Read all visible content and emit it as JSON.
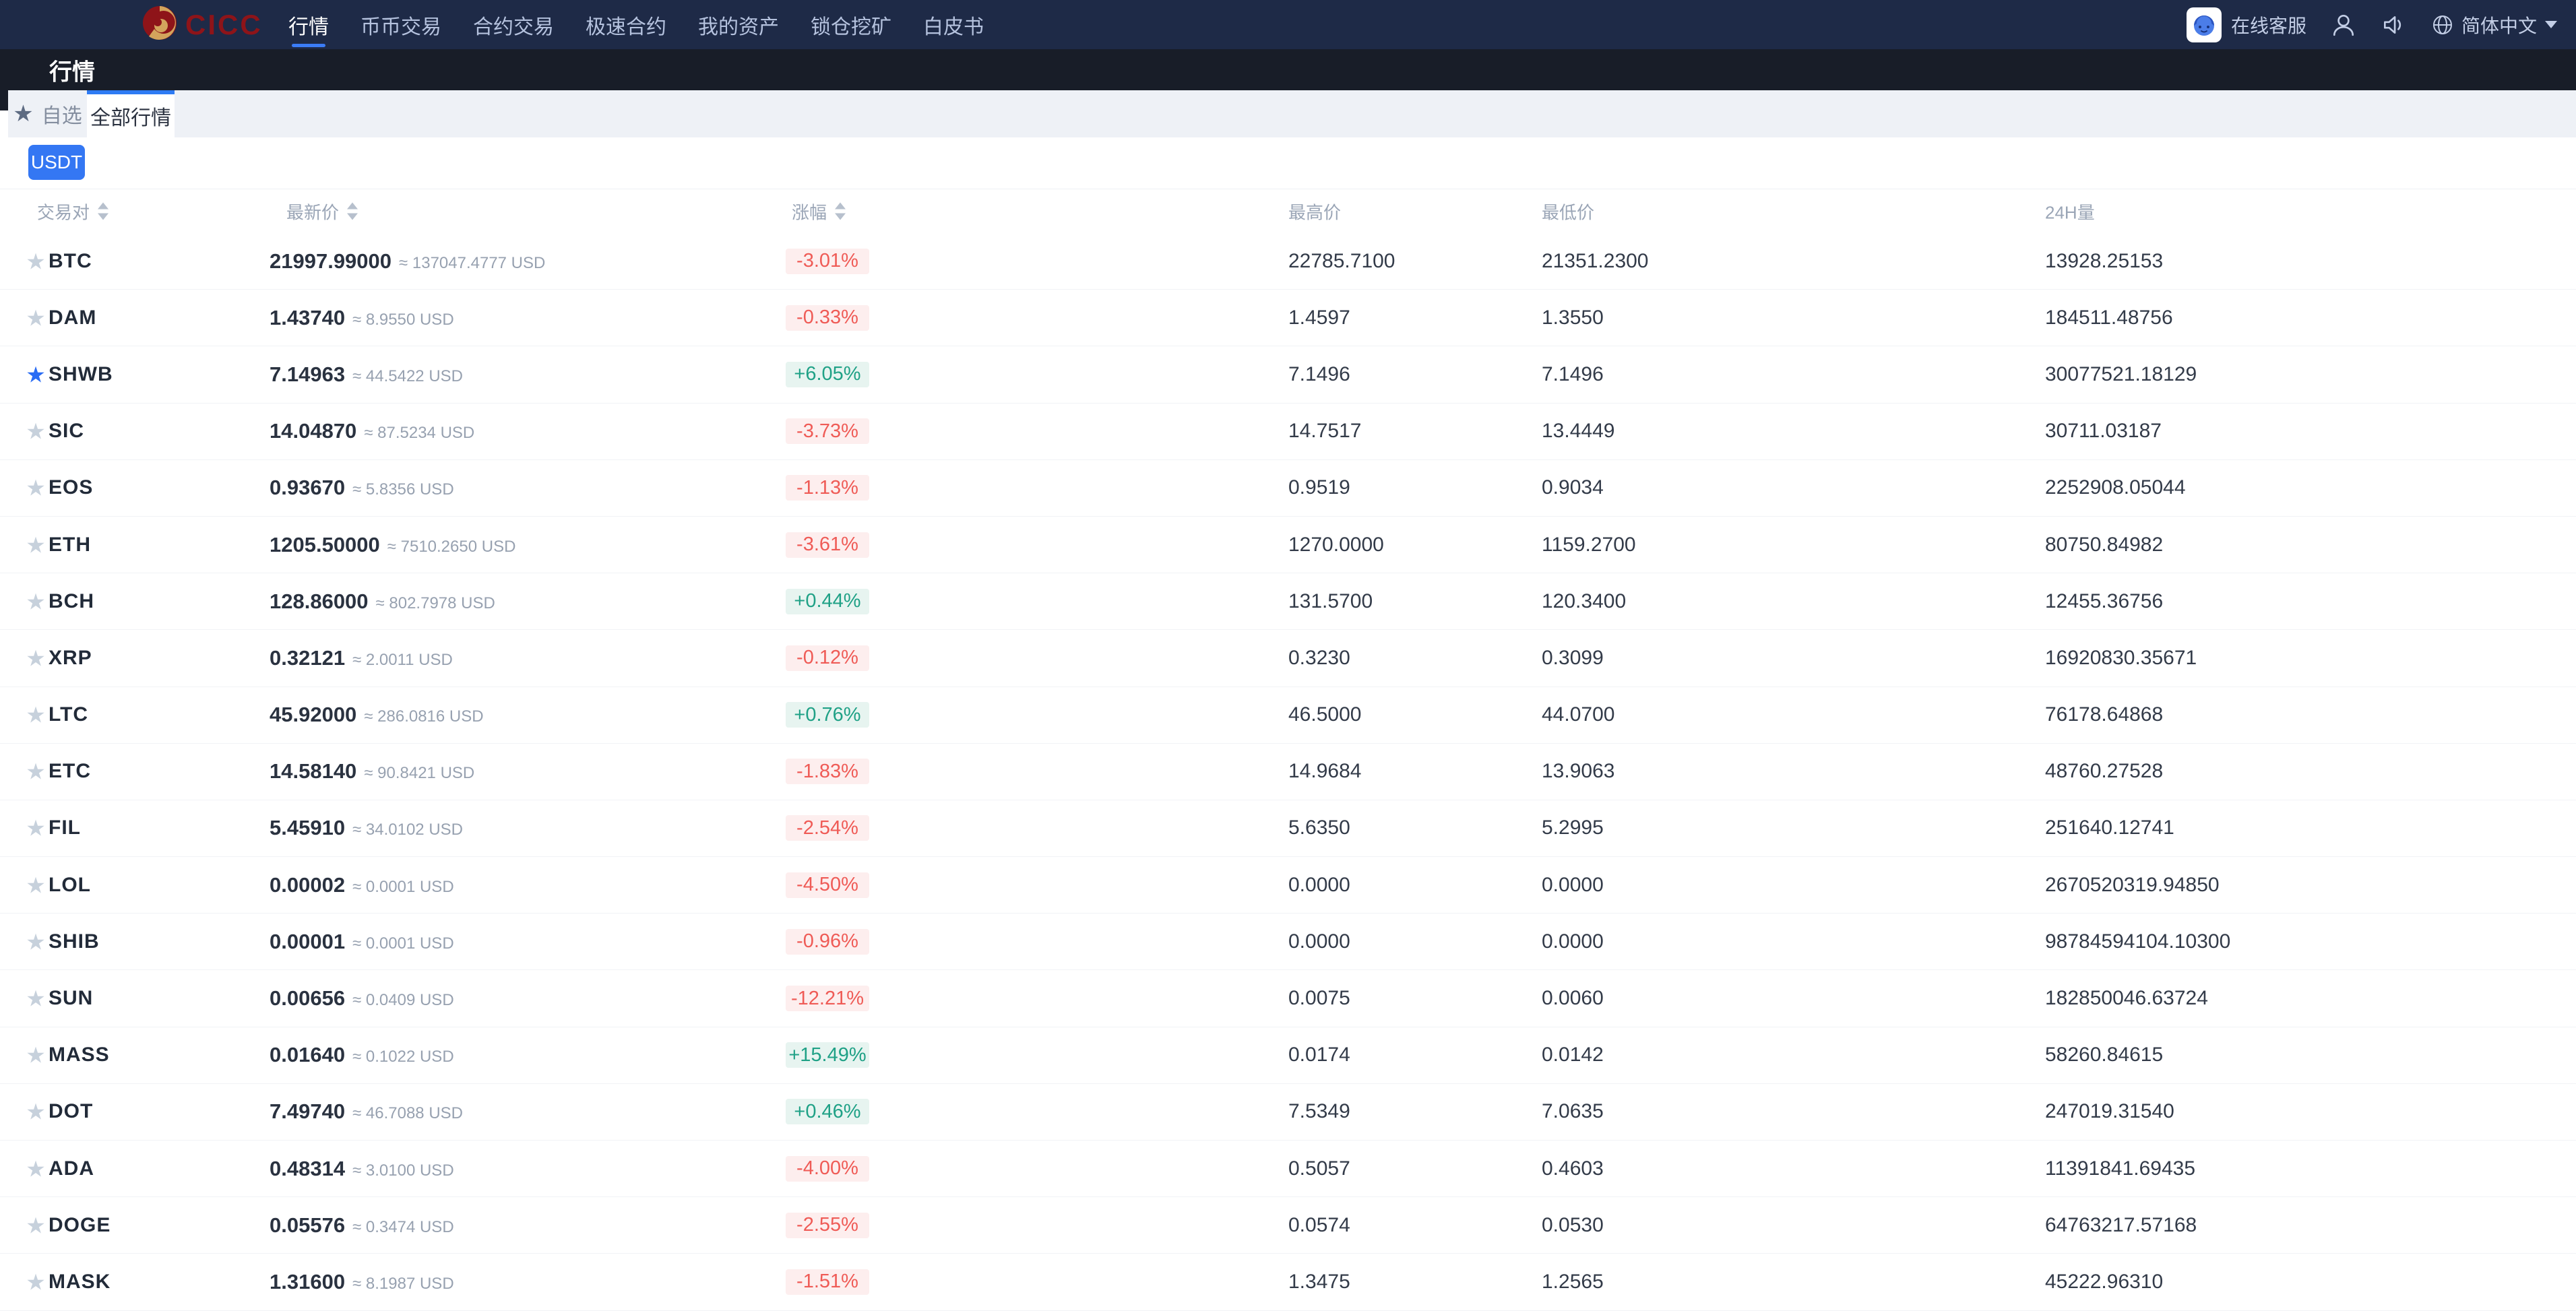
{
  "nav": {
    "brand": "CICC",
    "items": [
      {
        "label": "行情",
        "active": true
      },
      {
        "label": "币币交易",
        "active": false
      },
      {
        "label": "合约交易",
        "active": false
      },
      {
        "label": "极速合约",
        "active": false
      },
      {
        "label": "我的资产",
        "active": false
      },
      {
        "label": "锁仓挖矿",
        "active": false
      },
      {
        "label": "白皮书",
        "active": false
      }
    ],
    "right": {
      "support_label": "在线客服",
      "language": "简体中文"
    }
  },
  "subheader": {
    "title": "行情"
  },
  "tabs": [
    {
      "label": "自选",
      "active": false
    },
    {
      "label": "全部行情",
      "active": true
    }
  ],
  "filter": {
    "usdt_label": "USDT"
  },
  "icons": {
    "star": "★"
  },
  "colors": {
    "accent_blue": "#3477f3",
    "navbar_bg": "#1e2a47",
    "subbar_bg": "#181d28",
    "up_green": "#1fa186",
    "down_red": "#ef5b56",
    "brand_red": "#8e1419",
    "brand_gold": "#d3a45c"
  },
  "table": {
    "columns": [
      {
        "label": "交易对",
        "sortable": true
      },
      {
        "label": "最新价",
        "sortable": true
      },
      {
        "label": "涨幅",
        "sortable": true
      },
      {
        "label": "最高价",
        "sortable": false
      },
      {
        "label": "最低价",
        "sortable": false
      },
      {
        "label": "24H量",
        "sortable": false
      }
    ],
    "rows": [
      {
        "symbol": "BTC",
        "starred": false,
        "price": "21997.99000",
        "approx": "≈ 137047.4777 USD",
        "change": "-3.01%",
        "dir": "down",
        "high": "22785.7100",
        "low": "21351.2300",
        "volume": "13928.25153"
      },
      {
        "symbol": "DAM",
        "starred": false,
        "price": "1.43740",
        "approx": "≈ 8.9550 USD",
        "change": "-0.33%",
        "dir": "down",
        "high": "1.4597",
        "low": "1.3550",
        "volume": "184511.48756"
      },
      {
        "symbol": "SHWB",
        "starred": true,
        "price": "7.14963",
        "approx": "≈ 44.5422 USD",
        "change": "+6.05%",
        "dir": "up",
        "high": "7.1496",
        "low": "7.1496",
        "volume": "30077521.18129"
      },
      {
        "symbol": "SIC",
        "starred": false,
        "price": "14.04870",
        "approx": "≈ 87.5234 USD",
        "change": "-3.73%",
        "dir": "down",
        "high": "14.7517",
        "low": "13.4449",
        "volume": "30711.03187"
      },
      {
        "symbol": "EOS",
        "starred": false,
        "price": "0.93670",
        "approx": "≈ 5.8356 USD",
        "change": "-1.13%",
        "dir": "down",
        "high": "0.9519",
        "low": "0.9034",
        "volume": "2252908.05044"
      },
      {
        "symbol": "ETH",
        "starred": false,
        "price": "1205.50000",
        "approx": "≈ 7510.2650 USD",
        "change": "-3.61%",
        "dir": "down",
        "high": "1270.0000",
        "low": "1159.2700",
        "volume": "80750.84982"
      },
      {
        "symbol": "BCH",
        "starred": false,
        "price": "128.86000",
        "approx": "≈ 802.7978 USD",
        "change": "+0.44%",
        "dir": "up",
        "high": "131.5700",
        "low": "120.3400",
        "volume": "12455.36756"
      },
      {
        "symbol": "XRP",
        "starred": false,
        "price": "0.32121",
        "approx": "≈ 2.0011 USD",
        "change": "-0.12%",
        "dir": "down",
        "high": "0.3230",
        "low": "0.3099",
        "volume": "16920830.35671"
      },
      {
        "symbol": "LTC",
        "starred": false,
        "price": "45.92000",
        "approx": "≈ 286.0816 USD",
        "change": "+0.76%",
        "dir": "up",
        "high": "46.5000",
        "low": "44.0700",
        "volume": "76178.64868"
      },
      {
        "symbol": "ETC",
        "starred": false,
        "price": "14.58140",
        "approx": "≈ 90.8421 USD",
        "change": "-1.83%",
        "dir": "down",
        "high": "14.9684",
        "low": "13.9063",
        "volume": "48760.27528"
      },
      {
        "symbol": "FIL",
        "starred": false,
        "price": "5.45910",
        "approx": "≈ 34.0102 USD",
        "change": "-2.54%",
        "dir": "down",
        "high": "5.6350",
        "low": "5.2995",
        "volume": "251640.12741"
      },
      {
        "symbol": "LOL",
        "starred": false,
        "price": "0.00002",
        "approx": "≈ 0.0001 USD",
        "change": "-4.50%",
        "dir": "down",
        "high": "0.0000",
        "low": "0.0000",
        "volume": "2670520319.94850"
      },
      {
        "symbol": "SHIB",
        "starred": false,
        "price": "0.00001",
        "approx": "≈ 0.0001 USD",
        "change": "-0.96%",
        "dir": "down",
        "high": "0.0000",
        "low": "0.0000",
        "volume": "98784594104.10300"
      },
      {
        "symbol": "SUN",
        "starred": false,
        "price": "0.00656",
        "approx": "≈ 0.0409 USD",
        "change": "-12.21%",
        "dir": "down",
        "high": "0.0075",
        "low": "0.0060",
        "volume": "182850046.63724"
      },
      {
        "symbol": "MASS",
        "starred": false,
        "price": "0.01640",
        "approx": "≈ 0.1022 USD",
        "change": "+15.49%",
        "dir": "up",
        "high": "0.0174",
        "low": "0.0142",
        "volume": "58260.84615"
      },
      {
        "symbol": "DOT",
        "starred": false,
        "price": "7.49740",
        "approx": "≈ 46.7088 USD",
        "change": "+0.46%",
        "dir": "up",
        "high": "7.5349",
        "low": "7.0635",
        "volume": "247019.31540"
      },
      {
        "symbol": "ADA",
        "starred": false,
        "price": "0.48314",
        "approx": "≈ 3.0100 USD",
        "change": "-4.00%",
        "dir": "down",
        "high": "0.5057",
        "low": "0.4603",
        "volume": "11391841.69435"
      },
      {
        "symbol": "DOGE",
        "starred": false,
        "price": "0.05576",
        "approx": "≈ 0.3474 USD",
        "change": "-2.55%",
        "dir": "down",
        "high": "0.0574",
        "low": "0.0530",
        "volume": "64763217.57168"
      },
      {
        "symbol": "MASK",
        "starred": false,
        "price": "1.31600",
        "approx": "≈ 8.1987 USD",
        "change": "-1.51%",
        "dir": "down",
        "high": "1.3475",
        "low": "1.2565",
        "volume": "45222.96310"
      }
    ]
  }
}
